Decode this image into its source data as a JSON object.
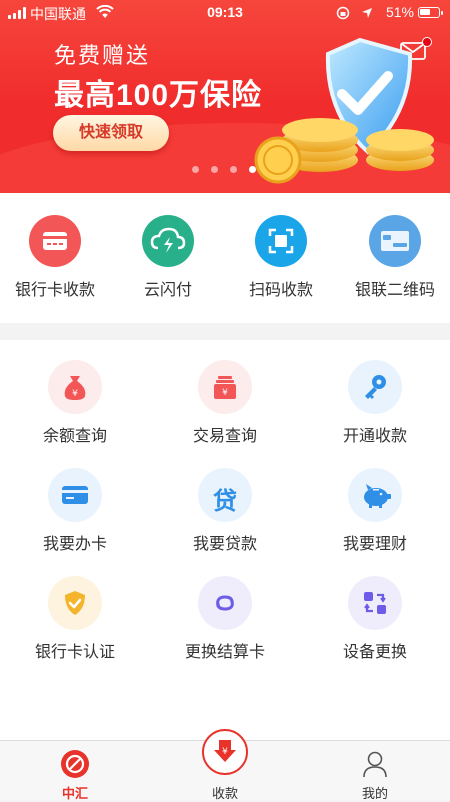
{
  "status_bar": {
    "carrier": "中国联通",
    "time": "09:13",
    "battery": "51%"
  },
  "banner": {
    "subtitle": "免费赠送",
    "headline": "最高100万保险",
    "cta_label": "快速领取",
    "page_count": 4,
    "active_page": 4,
    "accent": "#f12c2c"
  },
  "quick_actions": [
    {
      "label": "银行卡收款",
      "icon": "bank-card-icon",
      "color": "#f25656"
    },
    {
      "label": "云闪付",
      "icon": "cloud-flash-icon",
      "color": "#27b08a"
    },
    {
      "label": "扫码收款",
      "icon": "scan-icon",
      "color": "#1aa5e8"
    },
    {
      "label": "银联二维码",
      "icon": "unionpay-card-icon",
      "color": "#5aa5e6"
    }
  ],
  "services": [
    {
      "label": "余额查询",
      "icon": "money-bag-icon",
      "bg": "#fdecec",
      "fg": "#f25656"
    },
    {
      "label": "交易查询",
      "icon": "transaction-box-icon",
      "bg": "#fdecec",
      "fg": "#f25656"
    },
    {
      "label": "开通收款",
      "icon": "key-icon",
      "bg": "#e9f3fd",
      "fg": "#2f8fe6"
    },
    {
      "label": "我要办卡",
      "icon": "card-icon",
      "bg": "#e9f3fd",
      "fg": "#2f8fe6"
    },
    {
      "label": "我要贷款",
      "icon": "loan-icon",
      "bg": "#e9f3fd",
      "fg": "#2f8fe6",
      "glyph": "贷"
    },
    {
      "label": "我要理财",
      "icon": "piggy-bank-icon",
      "bg": "#e9f3fd",
      "fg": "#2f8fe6"
    },
    {
      "label": "银行卡认证",
      "icon": "shield-check-icon",
      "bg": "#fdf3df",
      "fg": "#f4b52c"
    },
    {
      "label": "更换结算卡",
      "icon": "swap-link-icon",
      "bg": "#efedfb",
      "fg": "#6c5ce7"
    },
    {
      "label": "设备更换",
      "icon": "device-swap-icon",
      "bg": "#efedfb",
      "fg": "#6c5ce7"
    }
  ],
  "tabs": [
    {
      "label": "中汇",
      "icon": "zhonghui-logo-icon",
      "active": true
    },
    {
      "label": "收款",
      "icon": "collect-icon",
      "active": false
    },
    {
      "label": "我的",
      "icon": "user-icon",
      "active": false
    }
  ]
}
